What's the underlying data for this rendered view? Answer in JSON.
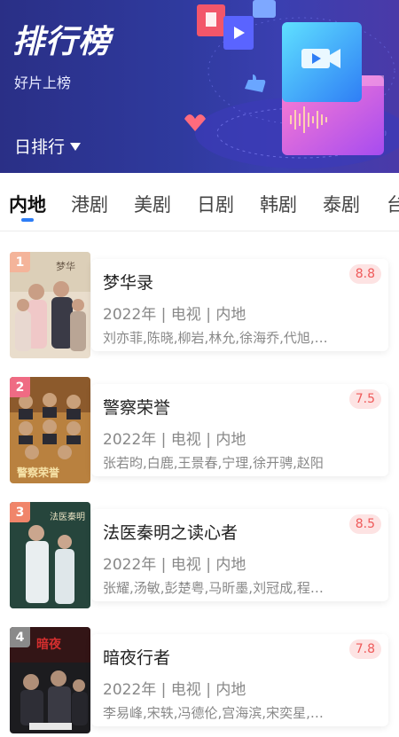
{
  "banner": {
    "title": "排行榜",
    "subtitle": "好片上榜",
    "period_label": "日排行"
  },
  "tabs": [
    {
      "label": "内地",
      "active": true
    },
    {
      "label": "港剧",
      "active": false
    },
    {
      "label": "美剧",
      "active": false
    },
    {
      "label": "日剧",
      "active": false
    },
    {
      "label": "韩剧",
      "active": false
    },
    {
      "label": "泰剧",
      "active": false
    },
    {
      "label": "台",
      "active": false
    }
  ],
  "colors": {
    "accent": "#2d7df6",
    "score_text": "#ef5a5a",
    "score_bg": "#fde3e3",
    "rank_1": "#f4b49a",
    "rank_2": "#ef6b83",
    "rank_3": "#f0856a",
    "rank_4": "#8a8a8a"
  },
  "rankings": [
    {
      "rank": "1",
      "title": "梦华录",
      "score": "8.8",
      "meta": "2022年 | 电视 | 内地",
      "cast": "刘亦菲,陈晓,柳岩,林允,徐海乔,代旭,…"
    },
    {
      "rank": "2",
      "title": "警察荣誉",
      "score": "7.5",
      "meta": "2022年 | 电视 | 内地",
      "cast": "张若昀,白鹿,王景春,宁理,徐开骋,赵阳"
    },
    {
      "rank": "3",
      "title": "法医秦明之读心者",
      "score": "8.5",
      "meta": "2022年 | 电视 | 内地",
      "cast": "张耀,汤敏,彭楚粤,马昕墨,刘冠成,程…"
    },
    {
      "rank": "4",
      "title": "暗夜行者",
      "score": "7.8",
      "meta": "2022年 | 电视 | 内地",
      "cast": "李易峰,宋轶,冯德伦,宫海滨,宋奕星,…"
    }
  ]
}
